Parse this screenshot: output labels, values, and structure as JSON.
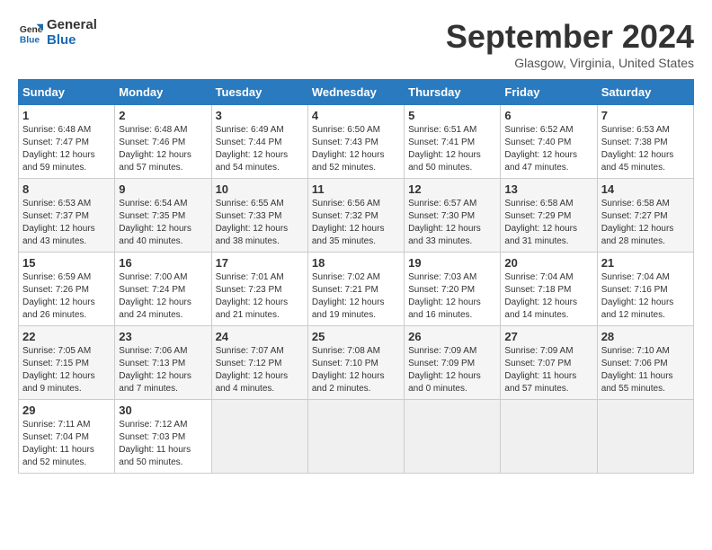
{
  "logo": {
    "line1": "General",
    "line2": "Blue"
  },
  "title": "September 2024",
  "location": "Glasgow, Virginia, United States",
  "weekdays": [
    "Sunday",
    "Monday",
    "Tuesday",
    "Wednesday",
    "Thursday",
    "Friday",
    "Saturday"
  ],
  "weeks": [
    [
      {
        "day": "1",
        "detail": "Sunrise: 6:48 AM\nSunset: 7:47 PM\nDaylight: 12 hours\nand 59 minutes."
      },
      {
        "day": "2",
        "detail": "Sunrise: 6:48 AM\nSunset: 7:46 PM\nDaylight: 12 hours\nand 57 minutes."
      },
      {
        "day": "3",
        "detail": "Sunrise: 6:49 AM\nSunset: 7:44 PM\nDaylight: 12 hours\nand 54 minutes."
      },
      {
        "day": "4",
        "detail": "Sunrise: 6:50 AM\nSunset: 7:43 PM\nDaylight: 12 hours\nand 52 minutes."
      },
      {
        "day": "5",
        "detail": "Sunrise: 6:51 AM\nSunset: 7:41 PM\nDaylight: 12 hours\nand 50 minutes."
      },
      {
        "day": "6",
        "detail": "Sunrise: 6:52 AM\nSunset: 7:40 PM\nDaylight: 12 hours\nand 47 minutes."
      },
      {
        "day": "7",
        "detail": "Sunrise: 6:53 AM\nSunset: 7:38 PM\nDaylight: 12 hours\nand 45 minutes."
      }
    ],
    [
      {
        "day": "8",
        "detail": "Sunrise: 6:53 AM\nSunset: 7:37 PM\nDaylight: 12 hours\nand 43 minutes."
      },
      {
        "day": "9",
        "detail": "Sunrise: 6:54 AM\nSunset: 7:35 PM\nDaylight: 12 hours\nand 40 minutes."
      },
      {
        "day": "10",
        "detail": "Sunrise: 6:55 AM\nSunset: 7:33 PM\nDaylight: 12 hours\nand 38 minutes."
      },
      {
        "day": "11",
        "detail": "Sunrise: 6:56 AM\nSunset: 7:32 PM\nDaylight: 12 hours\nand 35 minutes."
      },
      {
        "day": "12",
        "detail": "Sunrise: 6:57 AM\nSunset: 7:30 PM\nDaylight: 12 hours\nand 33 minutes."
      },
      {
        "day": "13",
        "detail": "Sunrise: 6:58 AM\nSunset: 7:29 PM\nDaylight: 12 hours\nand 31 minutes."
      },
      {
        "day": "14",
        "detail": "Sunrise: 6:58 AM\nSunset: 7:27 PM\nDaylight: 12 hours\nand 28 minutes."
      }
    ],
    [
      {
        "day": "15",
        "detail": "Sunrise: 6:59 AM\nSunset: 7:26 PM\nDaylight: 12 hours\nand 26 minutes."
      },
      {
        "day": "16",
        "detail": "Sunrise: 7:00 AM\nSunset: 7:24 PM\nDaylight: 12 hours\nand 24 minutes."
      },
      {
        "day": "17",
        "detail": "Sunrise: 7:01 AM\nSunset: 7:23 PM\nDaylight: 12 hours\nand 21 minutes."
      },
      {
        "day": "18",
        "detail": "Sunrise: 7:02 AM\nSunset: 7:21 PM\nDaylight: 12 hours\nand 19 minutes."
      },
      {
        "day": "19",
        "detail": "Sunrise: 7:03 AM\nSunset: 7:20 PM\nDaylight: 12 hours\nand 16 minutes."
      },
      {
        "day": "20",
        "detail": "Sunrise: 7:04 AM\nSunset: 7:18 PM\nDaylight: 12 hours\nand 14 minutes."
      },
      {
        "day": "21",
        "detail": "Sunrise: 7:04 AM\nSunset: 7:16 PM\nDaylight: 12 hours\nand 12 minutes."
      }
    ],
    [
      {
        "day": "22",
        "detail": "Sunrise: 7:05 AM\nSunset: 7:15 PM\nDaylight: 12 hours\nand 9 minutes."
      },
      {
        "day": "23",
        "detail": "Sunrise: 7:06 AM\nSunset: 7:13 PM\nDaylight: 12 hours\nand 7 minutes."
      },
      {
        "day": "24",
        "detail": "Sunrise: 7:07 AM\nSunset: 7:12 PM\nDaylight: 12 hours\nand 4 minutes."
      },
      {
        "day": "25",
        "detail": "Sunrise: 7:08 AM\nSunset: 7:10 PM\nDaylight: 12 hours\nand 2 minutes."
      },
      {
        "day": "26",
        "detail": "Sunrise: 7:09 AM\nSunset: 7:09 PM\nDaylight: 12 hours\nand 0 minutes."
      },
      {
        "day": "27",
        "detail": "Sunrise: 7:09 AM\nSunset: 7:07 PM\nDaylight: 11 hours\nand 57 minutes."
      },
      {
        "day": "28",
        "detail": "Sunrise: 7:10 AM\nSunset: 7:06 PM\nDaylight: 11 hours\nand 55 minutes."
      }
    ],
    [
      {
        "day": "29",
        "detail": "Sunrise: 7:11 AM\nSunset: 7:04 PM\nDaylight: 11 hours\nand 52 minutes."
      },
      {
        "day": "30",
        "detail": "Sunrise: 7:12 AM\nSunset: 7:03 PM\nDaylight: 11 hours\nand 50 minutes."
      },
      {
        "day": "",
        "detail": ""
      },
      {
        "day": "",
        "detail": ""
      },
      {
        "day": "",
        "detail": ""
      },
      {
        "day": "",
        "detail": ""
      },
      {
        "day": "",
        "detail": ""
      }
    ]
  ]
}
